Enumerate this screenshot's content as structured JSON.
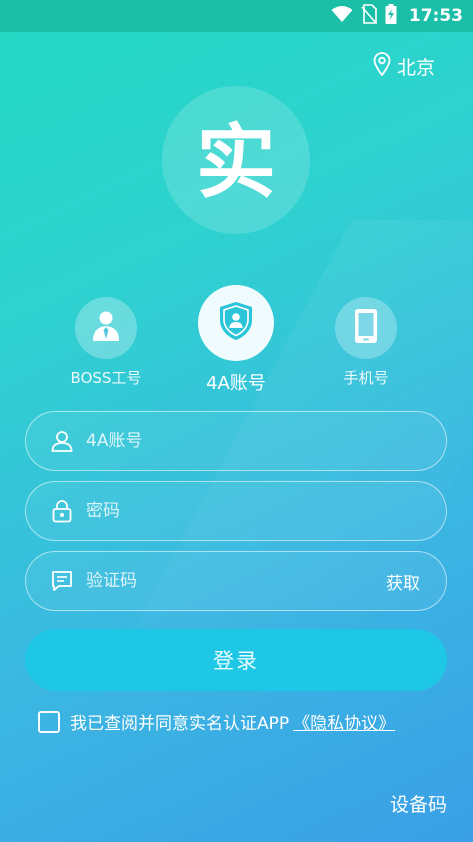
{
  "status_bar": {
    "time": "17:53",
    "icons": [
      "wifi-icon",
      "no-sim-icon",
      "battery-charging-icon"
    ]
  },
  "header": {
    "location": "北京",
    "location_icon": "location-pin-icon"
  },
  "logo": {
    "char": "实"
  },
  "login_types": [
    {
      "label": "BOSS工号",
      "icon": "person-tie-icon",
      "active": false
    },
    {
      "label": "4A账号",
      "icon": "shield-person-icon",
      "active": true
    },
    {
      "label": "手机号",
      "icon": "phone-icon",
      "active": false
    }
  ],
  "form": {
    "account_placeholder": "4A账号",
    "password_placeholder": "密码",
    "code_placeholder": "验证码",
    "get_code_label": "获取"
  },
  "login_button": "登录",
  "agreement": {
    "text": "我已查阅并同意实名认证APP",
    "link": "《隐私协议》",
    "checked": false
  },
  "device_code_label": "设备码",
  "colors": {
    "gradient_start": "#22d8c2",
    "gradient_end": "#3a9fe6",
    "status_bar": "#1bbfa8",
    "button": "#1ec7e6",
    "active_icon": "#2cc4d9"
  }
}
